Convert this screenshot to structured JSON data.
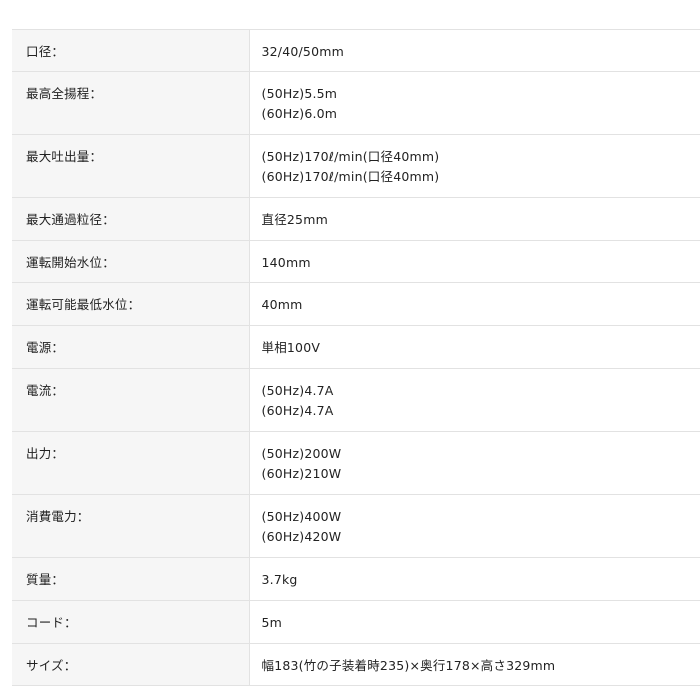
{
  "specs": [
    {
      "label": "口径：",
      "lines": [
        "32/40/50mm"
      ]
    },
    {
      "label": "最高全揚程：",
      "lines": [
        "(50Hz)5.5m",
        "(60Hz)6.0m"
      ]
    },
    {
      "label": "最大吐出量：",
      "lines": [
        "(50Hz)170ℓ/min(口径40mm)",
        "(60Hz)170ℓ/min(口径40mm)"
      ]
    },
    {
      "label": "最大通過粒径：",
      "lines": [
        "直径25mm"
      ]
    },
    {
      "label": "運転開始水位：",
      "lines": [
        "140mm"
      ]
    },
    {
      "label": "運転可能最低水位：",
      "lines": [
        "40mm"
      ]
    },
    {
      "label": "電源：",
      "lines": [
        "単相100V"
      ]
    },
    {
      "label": "電流：",
      "lines": [
        "(50Hz)4.7A",
        "(60Hz)4.7A"
      ]
    },
    {
      "label": "出力：",
      "lines": [
        "(50Hz)200W",
        "(60Hz)210W"
      ]
    },
    {
      "label": "消費電力：",
      "lines": [
        "(50Hz)400W",
        "(60Hz)420W"
      ]
    },
    {
      "label": "質量：",
      "lines": [
        "3.7kg"
      ]
    },
    {
      "label": "コード：",
      "lines": [
        "5m"
      ]
    },
    {
      "label": "サイズ：",
      "lines": [
        "幅183(竹の子装着時235)×奥行178×高さ329mm"
      ]
    }
  ]
}
